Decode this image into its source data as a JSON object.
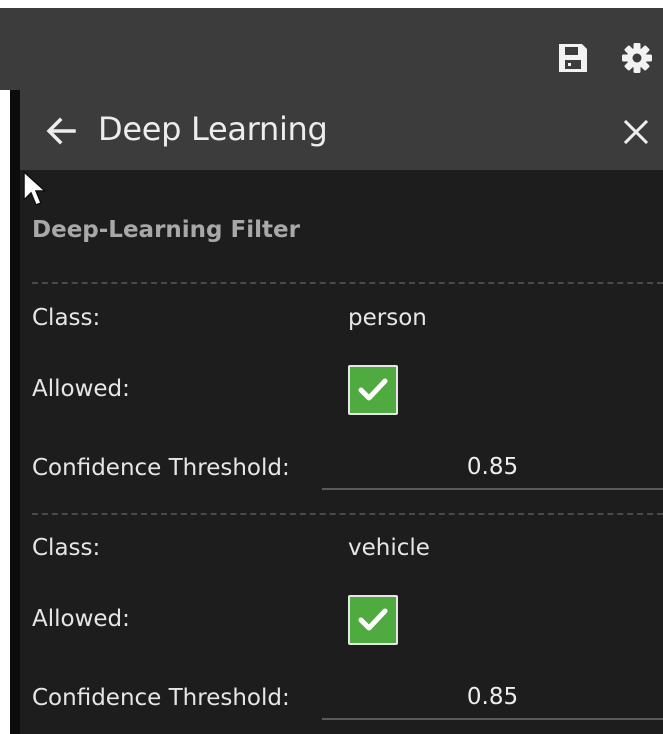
{
  "toolbar": {
    "save_icon": "floppy-disk-icon",
    "settings_icon": "gear-icon"
  },
  "panel": {
    "title": "Deep Learning",
    "back_icon": "arrow-left-icon",
    "close_icon": "close-icon"
  },
  "filter": {
    "section_title": "Deep-Learning Filter",
    "labels": {
      "class": "Class:",
      "allowed": "Allowed:",
      "confidence": "Confidence Threshold:"
    },
    "classes": [
      {
        "class": "person",
        "allowed": true,
        "threshold": "0.85"
      },
      {
        "class": "vehicle",
        "allowed": true,
        "threshold": "0.85"
      }
    ]
  },
  "colors": {
    "panel_background": "#1d1d1d",
    "header_background": "#3c3c3c",
    "checkbox_checked": "#4faa3f",
    "text": "#e6e6e6",
    "section_title": "#a8a8a8"
  }
}
